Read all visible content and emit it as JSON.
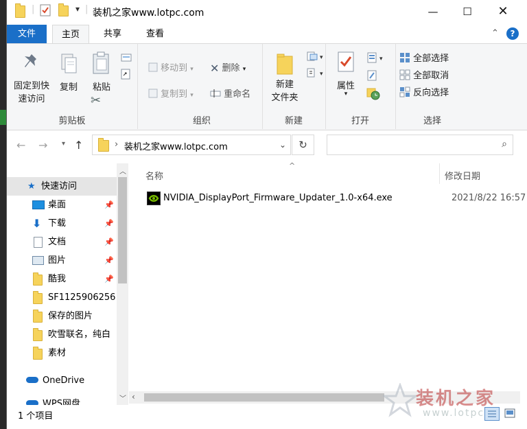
{
  "window": {
    "title": "装机之家www.lotpc.com"
  },
  "ribbon_tabs": [
    "文件",
    "主页",
    "共享",
    "查看"
  ],
  "ribbon": {
    "clipboard": {
      "label": "剪贴板",
      "pin_quick": "固定到快\n速访问",
      "copy": "复制",
      "paste": "粘贴"
    },
    "organize": {
      "label": "组织",
      "move_to": "移动到",
      "copy_to": "复制到",
      "delete": "删除",
      "rename": "重命名"
    },
    "new": {
      "label": "新建",
      "new_folder": "新建\n文件夹"
    },
    "open": {
      "label": "打开",
      "properties": "属性"
    },
    "select": {
      "label": "选择",
      "select_all": "全部选择",
      "select_none": "全部取消",
      "invert": "反向选择"
    }
  },
  "address": {
    "path": "装机之家www.lotpc.com"
  },
  "nav_pane": {
    "items": [
      {
        "label": "快速访问",
        "icon": "star-icon",
        "pinned": false
      },
      {
        "label": "桌面",
        "icon": "desktop-icon",
        "pinned": true
      },
      {
        "label": "下载",
        "icon": "download-icon",
        "pinned": true
      },
      {
        "label": "文档",
        "icon": "document-icon",
        "pinned": true
      },
      {
        "label": "图片",
        "icon": "pictures-icon",
        "pinned": true
      },
      {
        "label": "酷我",
        "icon": "folder-icon",
        "pinned": true
      },
      {
        "label": "SF1125906256",
        "icon": "folder-icon",
        "pinned": false
      },
      {
        "label": "保存的图片",
        "icon": "folder-icon",
        "pinned": false
      },
      {
        "label": "吹雪联名，纯白",
        "icon": "folder-icon",
        "pinned": false
      },
      {
        "label": "素材",
        "icon": "folder-icon",
        "pinned": false
      },
      {
        "label": "OneDrive",
        "icon": "cloud-icon",
        "pinned": false
      },
      {
        "label": "WPS网盘",
        "icon": "cloud-icon",
        "pinned": false
      }
    ]
  },
  "file_list": {
    "columns": [
      "名称",
      "修改日期"
    ],
    "rows": [
      {
        "name": "NVIDIA_DisplayPort_Firmware_Updater_1.0-x64.exe",
        "modified": "2021/8/22 16:57"
      }
    ]
  },
  "status": {
    "count": "1 个项目"
  },
  "watermark": {
    "text": "装机之家",
    "url": "www.lotpc"
  },
  "colors": {
    "accent": "#1a6fc8",
    "folder": "#f6d35b",
    "nvidia": "#76b900"
  }
}
